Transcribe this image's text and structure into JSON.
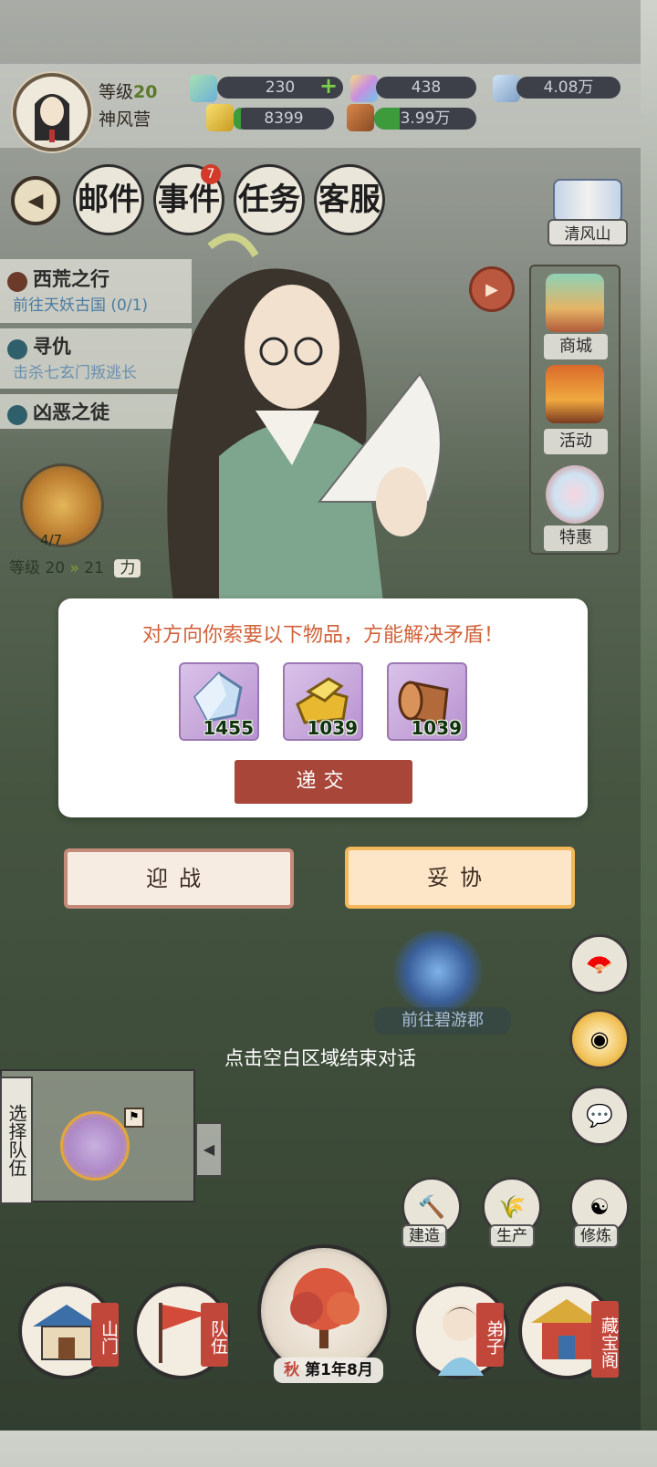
{
  "player": {
    "level_label": "等级",
    "level_value": "20",
    "camp_name": "神风营"
  },
  "resources": {
    "jade": "230",
    "crystal": "438",
    "stone": "4.08万",
    "gold": "8399",
    "wood": "3.99万",
    "add_symbol": "+"
  },
  "menu": {
    "mail": "邮件",
    "events": "事件",
    "events_badge": "7",
    "tasks": "任务",
    "service": "客服"
  },
  "right_column": {
    "mountain": "清风山",
    "shop": "商城",
    "activity": "活动",
    "special": "特惠"
  },
  "quests": [
    {
      "title": "西荒之行",
      "sub": "前往天妖古国 (0/1)"
    },
    {
      "title": "寻仇",
      "sub": "击杀七玄门叛逃长"
    },
    {
      "title": "凶恶之徒",
      "sub": ""
    }
  ],
  "sect": {
    "progress": "4/7",
    "level_from": "等级 20",
    "level_to": "21",
    "extra": "力"
  },
  "dialog": {
    "message": "对方向你索要以下物品，方能解决矛盾！",
    "items": [
      {
        "name": "stone-icon",
        "count": "1455"
      },
      {
        "name": "gold-icon",
        "count": "1039"
      },
      {
        "name": "wood-icon",
        "count": "1039"
      }
    ],
    "submit_label": "递交"
  },
  "actions": {
    "fight": "迎战",
    "compromise": "妥协"
  },
  "end_tip": "点击空白区域结束对话",
  "map": {
    "portal_label": "前往碧游郡"
  },
  "team": {
    "select_label": "选择队伍"
  },
  "tools": {
    "build": "建造",
    "produce": "生产",
    "cultivate": "修炼"
  },
  "bottom_nav": {
    "gate": "山门",
    "team": "队伍",
    "disciple": "弟子",
    "treasure": "藏宝阁",
    "season": "秋",
    "date": "第1年8月"
  },
  "colors": {
    "dialog_text": "#d0623a",
    "submit_bg": "#a8463a",
    "tag_red": "#c2473b",
    "quest_link": "#4b7aa0"
  }
}
